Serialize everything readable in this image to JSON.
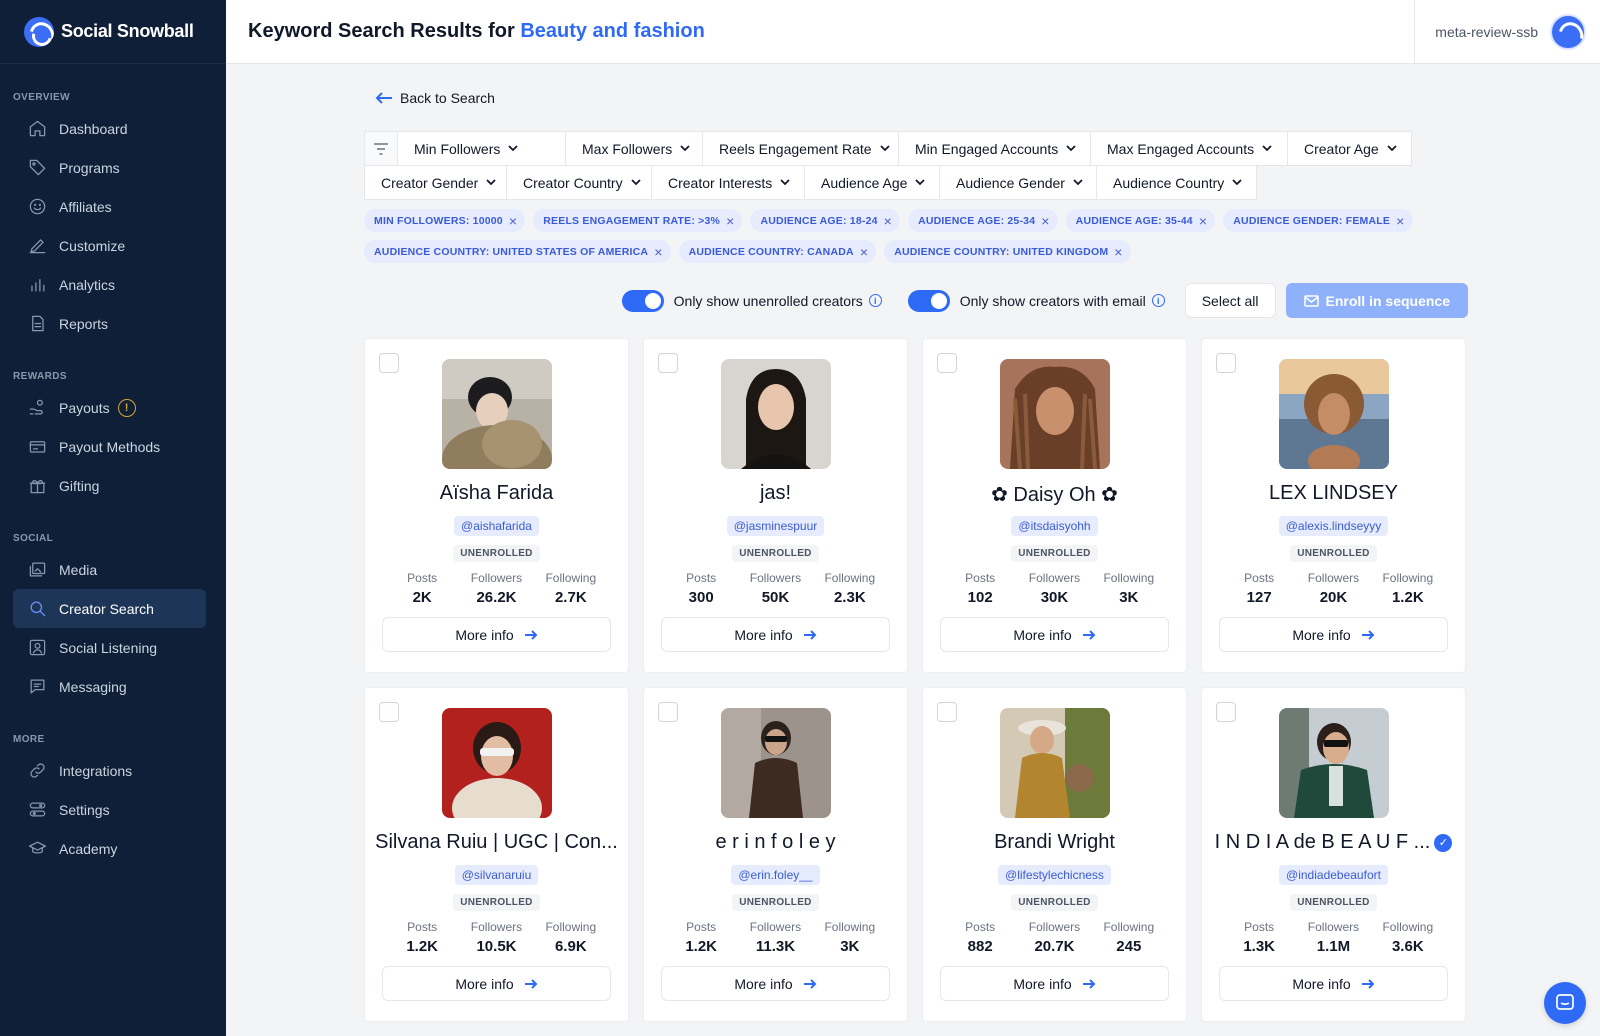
{
  "brand": {
    "name": "Social Snowball"
  },
  "header": {
    "title_prefix": "Keyword Search Results for",
    "keyword": "Beauty and fashion",
    "account": "meta-review-ssb"
  },
  "sidebar": {
    "overview": "OVERVIEW",
    "rewards": "REWARDS",
    "social": "SOCIAL",
    "more": "MORE",
    "items": [
      {
        "label": "Dashboard",
        "icon": "home-icon"
      },
      {
        "label": "Programs",
        "icon": "tag-icon"
      },
      {
        "label": "Affiliates",
        "icon": "smile-icon"
      },
      {
        "label": "Customize",
        "icon": "pen-icon"
      },
      {
        "label": "Analytics",
        "icon": "bar-chart-icon"
      },
      {
        "label": "Reports",
        "icon": "document-icon"
      },
      {
        "label": "Payouts",
        "icon": "hand-coins-icon",
        "badge": "!"
      },
      {
        "label": "Payout Methods",
        "icon": "credit-card-icon"
      },
      {
        "label": "Gifting",
        "icon": "gift-icon"
      },
      {
        "label": "Media",
        "icon": "images-icon"
      },
      {
        "label": "Creator Search",
        "icon": "search-icon"
      },
      {
        "label": "Social Listening",
        "icon": "user-square-icon"
      },
      {
        "label": "Messaging",
        "icon": "message-icon"
      },
      {
        "label": "Integrations",
        "icon": "link-icon"
      },
      {
        "label": "Settings",
        "icon": "sliders-icon"
      },
      {
        "label": "Academy",
        "icon": "graduation-cap-icon"
      }
    ]
  },
  "back_label": "Back to Search",
  "filters": {
    "row1": [
      "Min Followers",
      "Max Followers",
      "Reels Engagement Rate",
      "Min Engaged Accounts",
      "Max Engaged Accounts",
      "Creator Age"
    ],
    "row2": [
      "Creator Gender",
      "Creator Country",
      "Creator Interests",
      "Audience Age",
      "Audience Gender",
      "Audience Country"
    ]
  },
  "chips": [
    "MIN FOLLOWERS: 10000",
    "REELS ENGAGEMENT RATE: >3%",
    "AUDIENCE AGE: 18-24",
    "AUDIENCE AGE: 25-34",
    "AUDIENCE AGE: 35-44",
    "AUDIENCE GENDER: FEMALE",
    "AUDIENCE COUNTRY: UNITED STATES OF AMERICA",
    "AUDIENCE COUNTRY: CANADA",
    "AUDIENCE COUNTRY: UNITED KINGDOM"
  ],
  "controls": {
    "toggle_unenrolled": "Only show unenrolled creators",
    "toggle_email": "Only show creators with email",
    "select_all": "Select all",
    "enroll": "Enroll in sequence"
  },
  "stat_labels": {
    "posts": "Posts",
    "followers": "Followers",
    "following": "Following"
  },
  "more_info": "More info",
  "colors": {
    "sidebar": "#0f1f38",
    "accent": "#2f6af6",
    "chip_bg": "#e6ecfd",
    "chip_text": "#3b5bd6"
  },
  "creators": [
    {
      "name": "Aïsha Farida",
      "handle": "@aishafarida",
      "status": "UNENROLLED",
      "posts": "2K",
      "followers": "26.2K",
      "following": "2.7K",
      "verified": false
    },
    {
      "name": "jas!",
      "handle": "@jasminespuur",
      "status": "UNENROLLED",
      "posts": "300",
      "followers": "50K",
      "following": "2.3K",
      "verified": false
    },
    {
      "name": "✿ Daisy Oh ✿",
      "handle": "@itsdaisyohh",
      "status": "UNENROLLED",
      "posts": "102",
      "followers": "30K",
      "following": "3K",
      "verified": false
    },
    {
      "name": "LEX LINDSEY",
      "handle": "@alexis.lindseyyy",
      "status": "UNENROLLED",
      "posts": "127",
      "followers": "20K",
      "following": "1.2K",
      "verified": false
    },
    {
      "name": "Silvana Ruiu | UGC | Con...",
      "handle": "@silvanaruiu",
      "status": "UNENROLLED",
      "posts": "1.2K",
      "followers": "10.5K",
      "following": "6.9K",
      "verified": false
    },
    {
      "name": "e r i n  f o l e y",
      "handle": "@erin.foley__",
      "status": "UNENROLLED",
      "posts": "1.2K",
      "followers": "11.3K",
      "following": "3K",
      "verified": false
    },
    {
      "name": "Brandi Wright",
      "handle": "@lifestylechicness",
      "status": "UNENROLLED",
      "posts": "882",
      "followers": "20.7K",
      "following": "245",
      "verified": false
    },
    {
      "name": "I N D I A de B E A U F ...",
      "handle": "@indiadebeaufort",
      "status": "UNENROLLED",
      "posts": "1.3K",
      "followers": "1.1M",
      "following": "3.6K",
      "verified": true
    }
  ]
}
